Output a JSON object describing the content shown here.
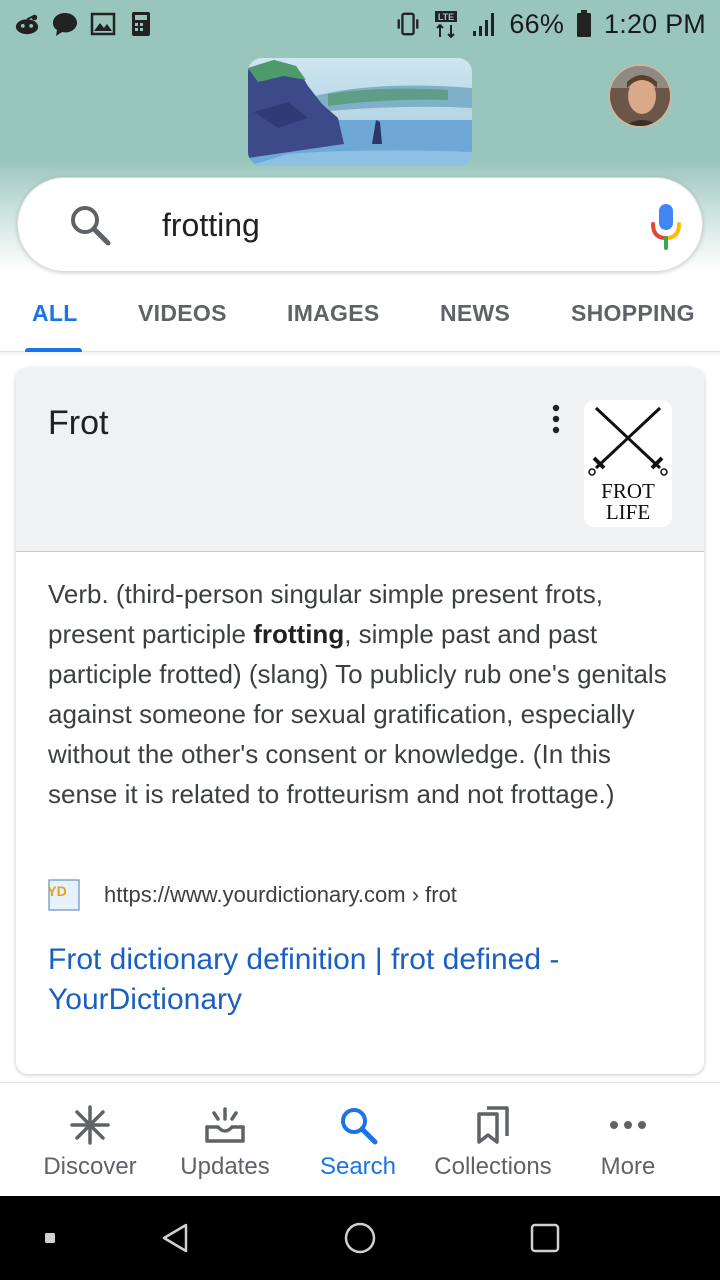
{
  "status_bar": {
    "battery": "66%",
    "time": "1:20 PM",
    "left_icons": [
      "reddit-icon",
      "chat-icon",
      "image-icon",
      "calculator-icon"
    ],
    "right_icons": [
      "vibrate-icon",
      "lte-icon",
      "signal-icon",
      "battery-icon"
    ]
  },
  "search": {
    "query": "frotting"
  },
  "tabs": [
    {
      "label": "ALL",
      "active": true
    },
    {
      "label": "VIDEOS",
      "active": false
    },
    {
      "label": "IMAGES",
      "active": false
    },
    {
      "label": "NEWS",
      "active": false
    },
    {
      "label": "SHOPPING",
      "active": false
    }
  ],
  "card": {
    "title": "Frot",
    "thumb_text_line1": "FROT",
    "thumb_text_line2": "LIFE",
    "definition_part1": "Verb. (third-person singular simple present frots, present participle ",
    "definition_bold": "frotting",
    "definition_part2": ", simple past and past participle frotted) (slang) To publicly rub one's genitals against someone for sexual gratification, especially without the other's consent or knowledge. (In this sense it is related to frotteurism and not frottage.)",
    "favicon_text": "YD",
    "source_url": "https://www.yourdictionary.com › frot",
    "link_text": "Frot dictionary definition | frot defined - YourDictionary"
  },
  "bottom_nav": [
    {
      "label": "Discover",
      "icon": "asterisk-icon",
      "active": false
    },
    {
      "label": "Updates",
      "icon": "inbox-icon",
      "active": false
    },
    {
      "label": "Search",
      "icon": "search-icon",
      "active": true
    },
    {
      "label": "Collections",
      "icon": "bookmarks-icon",
      "active": false
    },
    {
      "label": "More",
      "icon": "more-horiz-icon",
      "active": false
    }
  ],
  "colors": {
    "accent": "#1a73e8",
    "header_teal": "#98c6bc",
    "link": "#1a5fc2"
  }
}
